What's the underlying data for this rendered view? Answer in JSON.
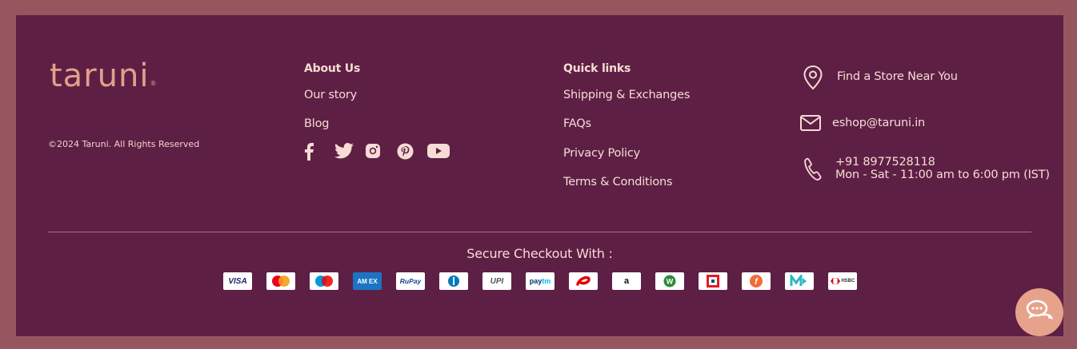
{
  "brand": {
    "logo_text": "taruni",
    "copyright": "©2024 Taruni. All Rights Reserved"
  },
  "about": {
    "title": "About Us",
    "links": [
      "Our story",
      "Blog"
    ]
  },
  "social": [
    "facebook-icon",
    "twitter-icon",
    "instagram-icon",
    "pinterest-icon",
    "youtube-icon"
  ],
  "quick_links": {
    "title": "Quick links",
    "links": [
      "Shipping & Exchanges",
      "FAQs",
      "Privacy Policy",
      "Terms & Conditions"
    ]
  },
  "contact": {
    "store": "Find a Store Near You",
    "email": "eshop@taruni.in",
    "phone": "+91 8977528118",
    "hours": "Mon - Sat - 11:00 am to 6:00 pm (IST)"
  },
  "checkout": {
    "title": "Secure Checkout With :",
    "methods": [
      "VISA",
      "Mastercard",
      "Maestro",
      "AMEX",
      "RuPay",
      "Diners",
      "UPI",
      "paytm",
      "Airtel",
      "amazon",
      "W",
      "HDFC",
      "Freecharge",
      "Mobikwik",
      "HSBC"
    ]
  },
  "colors": {
    "background": "#5e1f45",
    "accent": "#e2a08c",
    "outer": "#965660"
  }
}
